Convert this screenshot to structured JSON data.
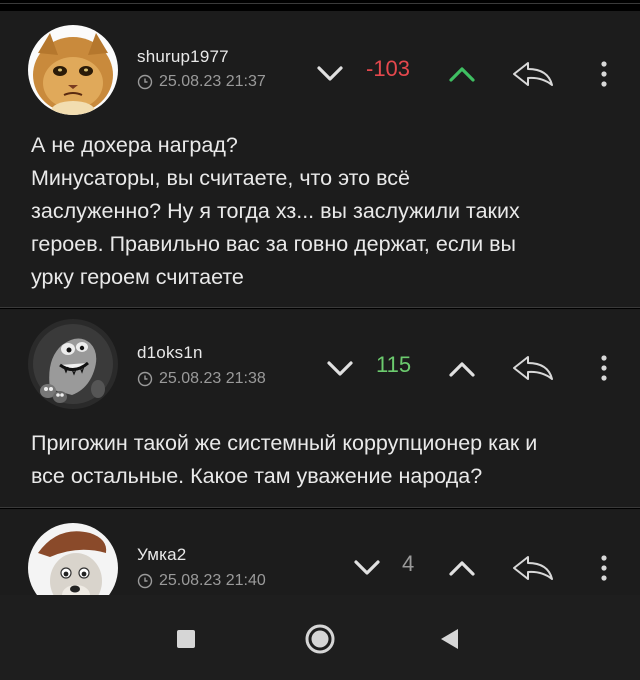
{
  "comments": [
    {
      "username": "shurup1977",
      "timestamp": "25.08.23 21:37",
      "score": "-103",
      "score_color": "#e5484d",
      "upvote_color": "#3fbf62",
      "downvote_color": "#e0e0e0",
      "text_lines": [
        "А не дохера наград?",
        "Минусаторы, вы считаете, что это всё",
        "заслуженно? Ну я тогда хз... вы заслужили таких",
        "героев. Правильно вас за говно держат, если вы",
        "урку героем считаете"
      ],
      "avatar": "cat-avatar"
    },
    {
      "username": "d1oks1n",
      "timestamp": "25.08.23 21:38",
      "score": "115",
      "score_color": "#6ccb6e",
      "upvote_color": "#e0e0e0",
      "downvote_color": "#e0e0e0",
      "text_lines": [
        "Пригожин такой же системный коррупционер как и",
        "все остальные. Какое там уважение народа?"
      ],
      "avatar": "monster-avatar"
    },
    {
      "username": "Умка2",
      "timestamp": "25.08.23 21:40",
      "score": "4",
      "score_color": "#9a9a9a",
      "upvote_color": "#e0e0e0",
      "downvote_color": "#e0e0e0",
      "text_lines": [],
      "avatar": "bear-cub-avatar"
    }
  ],
  "icons": {
    "downvote": "chevron-down-icon",
    "upvote": "chevron-up-icon",
    "share": "reply-arrow-icon",
    "more": "vertical-dots-icon",
    "clock": "clock-icon"
  },
  "navbar": {
    "buttons": [
      "recent-apps-square-icon",
      "home-circle-icon",
      "back-triangle-icon"
    ],
    "icon_color": "#d6d6d6"
  }
}
